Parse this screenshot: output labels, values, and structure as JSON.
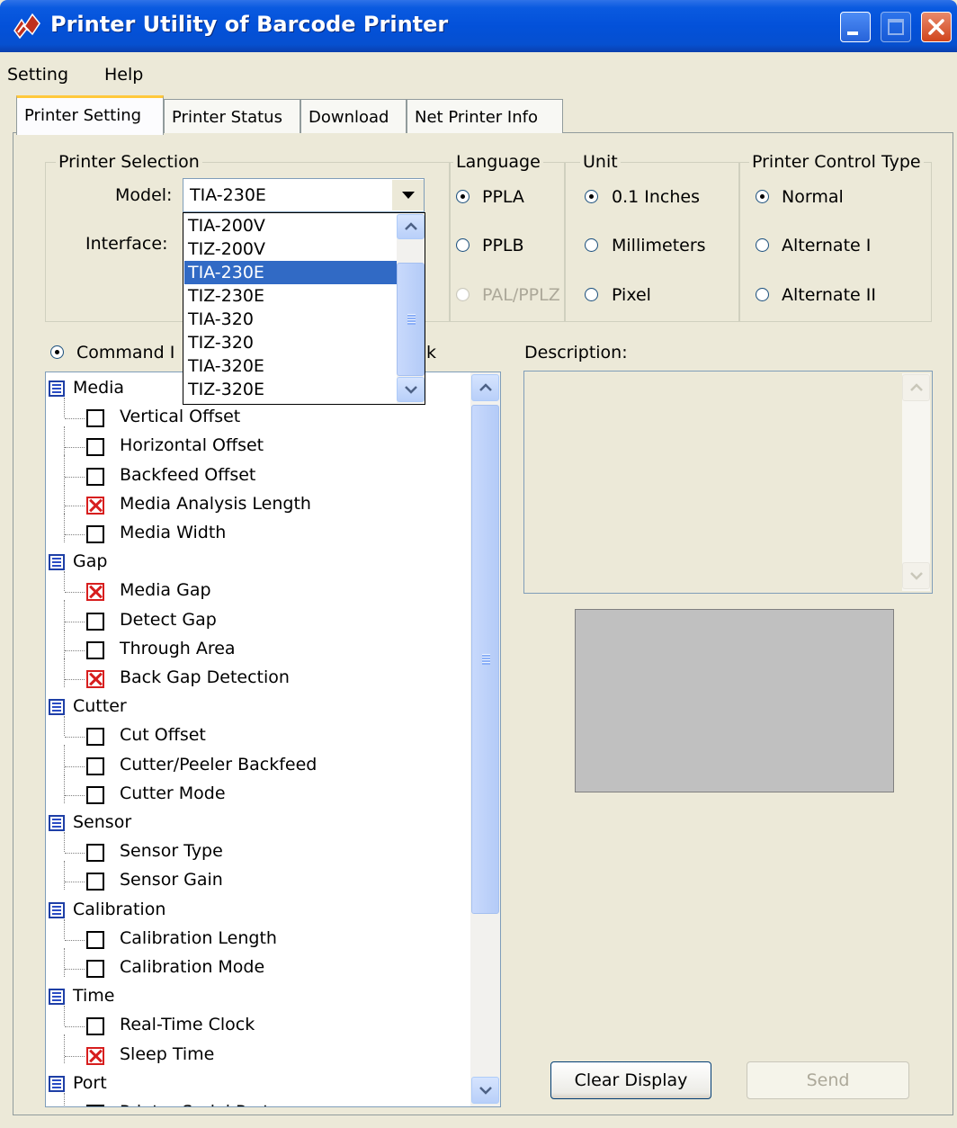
{
  "window": {
    "title": "Printer Utility of Barcode Printer"
  },
  "menu": [
    "Setting",
    "Help"
  ],
  "tabs": [
    "Printer Setting",
    "Printer Status",
    "Download",
    "Net Printer Info"
  ],
  "printer_selection": {
    "group_label": "Printer Selection",
    "model_label": "Model:",
    "model_value": "TIA-230E",
    "interface_label": "Interface:",
    "dropdown_options": [
      "TIA-200V",
      "TIZ-200V",
      "TIA-230E",
      "TIZ-230E",
      "TIA-320",
      "TIZ-320",
      "TIA-320E",
      "TIZ-320E"
    ],
    "selected_option": "TIA-230E"
  },
  "language": {
    "group_label": "Language",
    "options": [
      "PPLA",
      "PPLB",
      "PAL/PPLZ"
    ],
    "selected": "PPLA",
    "disabled": [
      "PAL/PPLZ"
    ]
  },
  "unit": {
    "group_label": "Unit",
    "options": [
      "0.1 Inches",
      "Millimeters",
      "Pixel"
    ],
    "selected": "0.1 Inches"
  },
  "control_type": {
    "group_label": "Printer Control Type",
    "options": [
      "Normal",
      "Alternate I",
      "Alternate II"
    ],
    "selected": "Normal"
  },
  "command_mode": {
    "visible_label": "Command I",
    "trailing_visible_text": "k"
  },
  "description_label": "Description:",
  "tree": [
    {
      "category": "Media",
      "items": [
        {
          "label": "Vertical Offset",
          "state": "unchecked"
        },
        {
          "label": "Horizontal Offset",
          "state": "unchecked"
        },
        {
          "label": "Backfeed Offset",
          "state": "unchecked"
        },
        {
          "label": "Media Analysis Length",
          "state": "unsupported"
        },
        {
          "label": "Media Width",
          "state": "unchecked"
        }
      ]
    },
    {
      "category": "Gap",
      "items": [
        {
          "label": "Media Gap",
          "state": "unsupported"
        },
        {
          "label": "Detect Gap",
          "state": "unchecked"
        },
        {
          "label": "Through Area",
          "state": "unchecked"
        },
        {
          "label": "Back Gap Detection",
          "state": "unsupported"
        }
      ]
    },
    {
      "category": "Cutter",
      "items": [
        {
          "label": "Cut Offset",
          "state": "unchecked"
        },
        {
          "label": "Cutter/Peeler Backfeed",
          "state": "unchecked"
        },
        {
          "label": "Cutter Mode",
          "state": "unchecked"
        }
      ]
    },
    {
      "category": "Sensor",
      "items": [
        {
          "label": "Sensor Type",
          "state": "unchecked"
        },
        {
          "label": "Sensor Gain",
          "state": "unchecked"
        }
      ]
    },
    {
      "category": "Calibration",
      "items": [
        {
          "label": "Calibration Length",
          "state": "unchecked"
        },
        {
          "label": "Calibration Mode",
          "state": "unchecked"
        }
      ]
    },
    {
      "category": "Time",
      "items": [
        {
          "label": "Real-Time Clock",
          "state": "unchecked"
        },
        {
          "label": "Sleep Time",
          "state": "unsupported"
        }
      ]
    },
    {
      "category": "Port",
      "items": [
        {
          "label": "Printer Serial Port",
          "state": "unchecked"
        }
      ]
    }
  ],
  "buttons": {
    "clear_display": "Clear Display",
    "send": "Send"
  }
}
